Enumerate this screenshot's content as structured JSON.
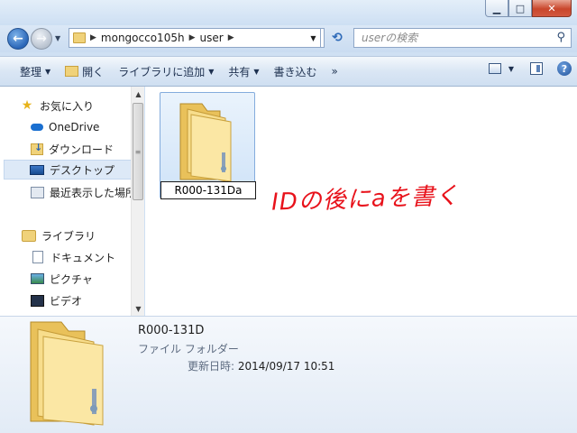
{
  "window": {
    "buttons": {
      "minimize": "▁",
      "maximize": "□",
      "close": "✕"
    }
  },
  "address": {
    "path": [
      "mongocco105h",
      "user"
    ],
    "separator": "▶",
    "search_placeholder": "userの検索"
  },
  "toolbar": {
    "organize": "整理",
    "open": "開く",
    "add_library": "ライブラリに追加",
    "share": "共有",
    "burn": "書き込む",
    "more": "»"
  },
  "sidebar": {
    "items": [
      {
        "label": "お気に入り",
        "icon": "star-icon"
      },
      {
        "label": "OneDrive",
        "icon": "cloud-icon"
      },
      {
        "label": "ダウンロード",
        "icon": "download-folder-icon"
      },
      {
        "label": "デスクトップ",
        "icon": "desktop-icon",
        "selected": true
      },
      {
        "label": "最近表示した場所",
        "icon": "recent-places-icon"
      },
      {
        "label": "ライブラリ",
        "icon": "library-icon"
      },
      {
        "label": "ドキュメント",
        "icon": "document-icon"
      },
      {
        "label": "ピクチャ",
        "icon": "picture-icon"
      },
      {
        "label": "ビデオ",
        "icon": "video-icon"
      }
    ]
  },
  "content": {
    "rename_value": "R000-131Da",
    "annotation": "IDの後にaを書く"
  },
  "details": {
    "name": "R000-131D",
    "type": "ファイル フォルダー",
    "modified_label": "更新日時:",
    "modified_value": "2014/09/17 10:51"
  },
  "colors": {
    "accent": "#2a66b8",
    "annotation": "#e8121b",
    "selection": "#cfe3f8"
  }
}
